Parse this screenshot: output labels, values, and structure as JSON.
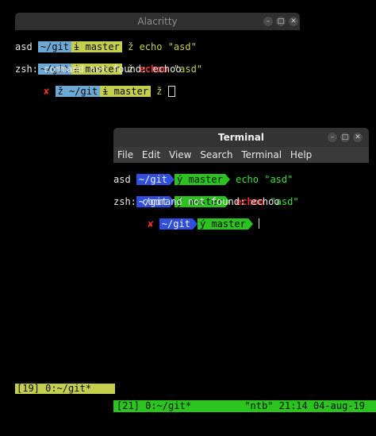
{
  "alacritty": {
    "title": "Alacritty",
    "lines": [
      {
        "dir": "~/git",
        "branch_icon": "ɨ",
        "branch": "master",
        "prompt": "ž",
        "cmd": "echo",
        "args": "\"asd\""
      },
      {
        "output": "asd"
      },
      {
        "dir": "~/git",
        "branch_icon": "ɨ",
        "branch": "master",
        "prompt": "ž",
        "cmd": "echoo",
        "args": "\"asd\""
      },
      {
        "output": "zsh: command not found: echoo"
      },
      {
        "status": "✘",
        "prompt_icon": "ž",
        "dir": "~/git",
        "branch_icon": "ɨ",
        "branch": "master",
        "prompt": "ž"
      }
    ]
  },
  "terminal": {
    "title": "Terminal",
    "menu": [
      "File",
      "Edit",
      "View",
      "Search",
      "Terminal",
      "Help"
    ],
    "lines": [
      {
        "dir": "~/git",
        "branch_icon": "ý",
        "branch": "master",
        "cmd": "echo",
        "args": "\"asd\""
      },
      {
        "output": "asd"
      },
      {
        "dir": "~/git",
        "branch_icon": "ý",
        "branch": "master",
        "cmd": "echoo",
        "args": "\"asd\""
      },
      {
        "output": "zsh: command not found: echoo"
      },
      {
        "status": "✘",
        "dir": "~/git",
        "branch_icon": "ý",
        "branch": "master"
      }
    ]
  },
  "tmux": {
    "left_status": "[19] 0:~/git*",
    "bottom_left": "[21] 0:~/git*",
    "bottom_right": "\"ntb\" 21:14 04-aug-19"
  },
  "colors": {
    "alacritty_dir": "#6ea9d4",
    "alacritty_git": "#c5cf4e",
    "terminal_dir": "#2f4fdc",
    "terminal_git": "#2bc41e",
    "error": "#ef3030"
  }
}
